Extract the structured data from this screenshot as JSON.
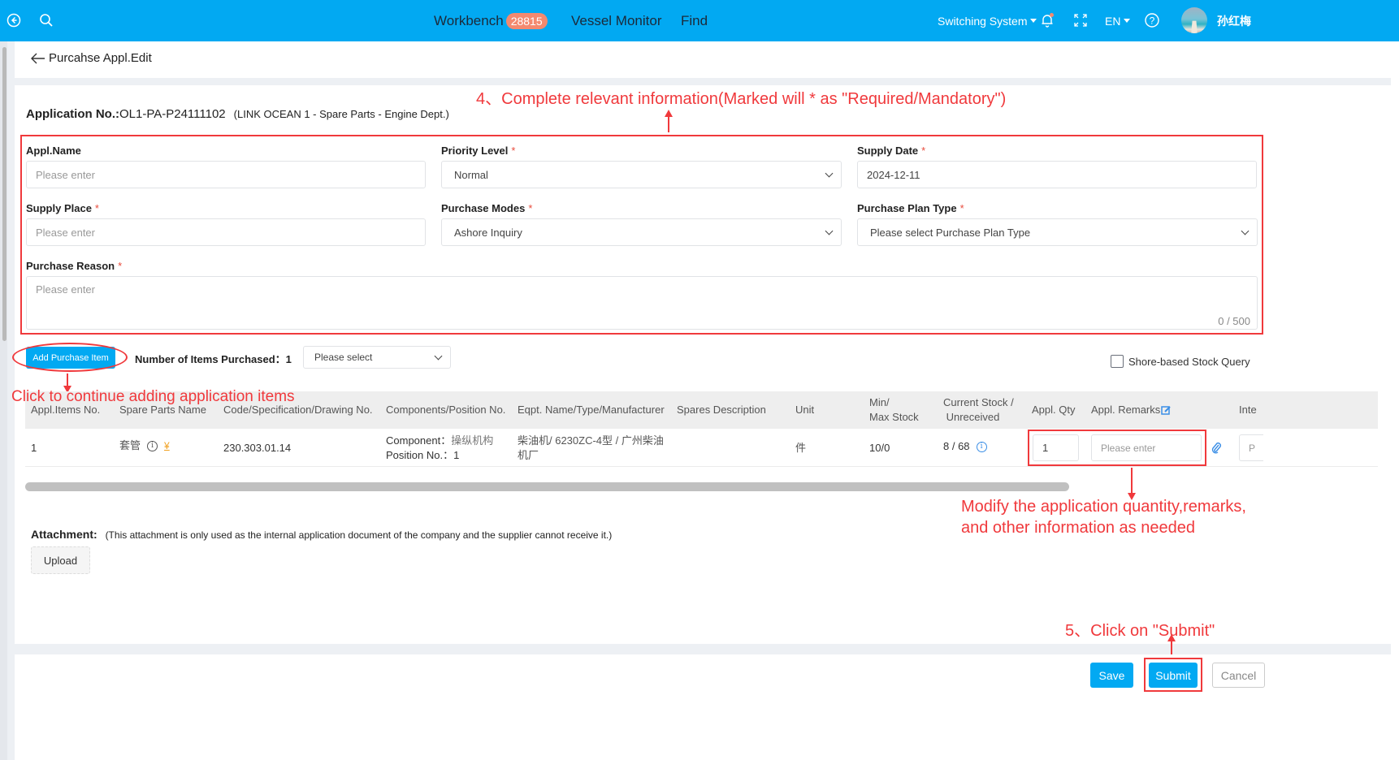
{
  "topbar": {
    "nav": [
      {
        "label": "Workbench",
        "badge": "28815"
      },
      {
        "label": "Vessel Monitor"
      },
      {
        "label": "Find"
      }
    ],
    "switching_system": "Switching System",
    "language": "EN",
    "user_name": "孙红梅",
    "icons": {
      "back": "back-circle-icon",
      "search": "search-icon",
      "bell": "bell-icon",
      "fullscreen": "fullscreen-icon",
      "help": "help-icon"
    }
  },
  "page": {
    "back_label": "Purcahse Appl.Edit",
    "app_no_label": "Application No.:",
    "app_no_value": "OL1-PA-P24111102",
    "app_no_sub": "(LINK OCEAN 1 - Spare Parts - Engine Dept.)"
  },
  "form": {
    "appl_name": {
      "label": "Appl.Name",
      "placeholder": "Please enter",
      "value": ""
    },
    "priority_level": {
      "label": "Priority Level",
      "required": "*",
      "value": "Normal"
    },
    "supply_date": {
      "label": "Supply Date",
      "required": "*",
      "value": "2024-12-11"
    },
    "supply_place": {
      "label": "Supply Place",
      "required": "*",
      "placeholder": "Please enter",
      "value": ""
    },
    "purchase_modes": {
      "label": "Purchase Modes",
      "required": "*",
      "value": "Ashore Inquiry"
    },
    "purchase_plan_type": {
      "label": "Purchase Plan Type",
      "required": "*",
      "placeholder": "Please select Purchase Plan Type"
    },
    "purchase_reason": {
      "label": "Purchase Reason",
      "required": "*",
      "placeholder": "Please enter",
      "counter": "0 / 500"
    }
  },
  "items_bar": {
    "add_button": "Add Purchase Item",
    "count_label": "Number of Items Purchased：",
    "count_value": "1",
    "select_placeholder": "Please select",
    "shore_stock_label": "Shore-based Stock Query",
    "shore_stock_checked": false
  },
  "table": {
    "columns": [
      "Appl.Items No.",
      "Spare Parts Name",
      "Code/Specification/Drawing No.",
      "Components/Position No.",
      "Eqpt. Name/Type/Manufacturer",
      "Spares Description",
      "Unit",
      "Min/\nMax Stock",
      "Current Stock /\n Unreceived",
      "Appl. Qty",
      "Appl. Remarks",
      "Inte"
    ],
    "rows": [
      {
        "no": "1",
        "spare_name": "套管",
        "code": "230.303.01.14",
        "component_label": "Component：",
        "component_value": "操纵机构",
        "position_label": "Position No.：",
        "position_value": "1",
        "eqpt_line1": "柴油机/ 6230ZC-4型 / 广州柴油",
        "eqpt_line2": "机厂",
        "description": "",
        "unit": "件",
        "min_max": "10/0",
        "stock": "8 / 68",
        "qty": "1",
        "remarks_placeholder": "Please enter",
        "next_placeholder": "P"
      }
    ]
  },
  "attachment": {
    "label": "Attachment:",
    "note": "(This attachment is only used as the internal application document of the company and the supplier cannot receive it.)",
    "upload_button": "Upload"
  },
  "footer": {
    "save": "Save",
    "submit": "Submit",
    "cancel": "Cancel"
  },
  "annotations": {
    "step4": "4、Complete relevant information(Marked will * as \"Required/Mandatory\")",
    "add_items": "Click to continue adding application items",
    "modify_line1": "Modify the application quantity,remarks,",
    "modify_line2": "and other information as needed",
    "step5": "5、Click on \"Submit\""
  },
  "colors": {
    "brand": "#02a9f2",
    "annotation": "#f0393c",
    "badge": "#f4896f",
    "required": "#e84c3d"
  }
}
